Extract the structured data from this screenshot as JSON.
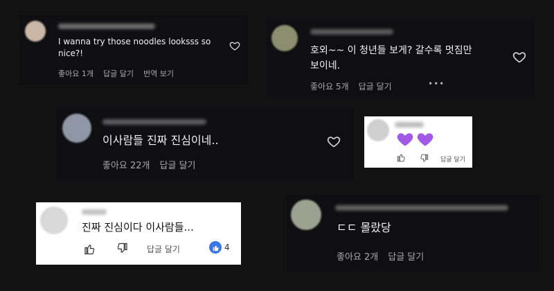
{
  "cards": [
    {
      "comment": "I wanna try those noodles looksss so nice?!",
      "actions": [
        "좋아요 1개",
        "답글 달기",
        "번역 보기"
      ]
    },
    {
      "comment": "호외~~ 이 청년들 보게? 갈수록 멋짐만\n보이네.",
      "actions": [
        "좋아요 5개",
        "답글 달기"
      ],
      "more": "•••"
    },
    {
      "comment": "이사람들 진짜 진심이네..",
      "actions": [
        "좋아요 22개",
        "답글 달기"
      ]
    },
    {
      "actions": [
        "답글 달기"
      ]
    },
    {
      "comment": "진짜 진심이다 이사람들...",
      "actions": [
        "답글 달기"
      ],
      "likes": "4"
    },
    {
      "comment": "ㄷㄷ 몰랐당",
      "actions": [
        "좋아요 2개",
        "답글 달기"
      ]
    }
  ],
  "colors": {
    "dark_card": "#0f0f12",
    "purple_heart": "#a259e6",
    "like_badge": "#3b78e7"
  }
}
